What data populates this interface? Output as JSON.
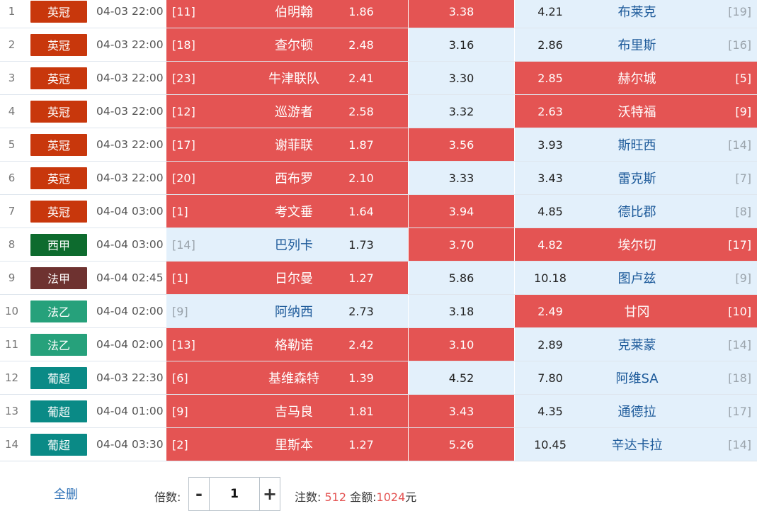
{
  "rows": [
    {
      "index": "1",
      "league": "英冠",
      "league_color": "#c8370c",
      "time": "04-03 22:00",
      "home_rank": "[11]",
      "home": "伯明翰",
      "home_odds": "1.86",
      "draw_odds": "3.38",
      "away_odds": "4.21",
      "away": "布莱克",
      "away_rank": "[19]",
      "selected": {
        "home": true,
        "draw": true,
        "away": false
      }
    },
    {
      "index": "2",
      "league": "英冠",
      "league_color": "#c8370c",
      "time": "04-03 22:00",
      "home_rank": "[18]",
      "home": "查尔顿",
      "home_odds": "2.48",
      "draw_odds": "3.16",
      "away_odds": "2.86",
      "away": "布里斯",
      "away_rank": "[16]",
      "selected": {
        "home": true,
        "draw": false,
        "away": false
      }
    },
    {
      "index": "3",
      "league": "英冠",
      "league_color": "#c8370c",
      "time": "04-03 22:00",
      "home_rank": "[23]",
      "home": "牛津联队",
      "home_odds": "2.41",
      "draw_odds": "3.30",
      "away_odds": "2.85",
      "away": "赫尔城",
      "away_rank": "[5]",
      "selected": {
        "home": true,
        "draw": false,
        "away": true
      }
    },
    {
      "index": "4",
      "league": "英冠",
      "league_color": "#c8370c",
      "time": "04-03 22:00",
      "home_rank": "[12]",
      "home": "巡游者",
      "home_odds": "2.58",
      "draw_odds": "3.32",
      "away_odds": "2.63",
      "away": "沃特福",
      "away_rank": "[9]",
      "selected": {
        "home": true,
        "draw": false,
        "away": true
      }
    },
    {
      "index": "5",
      "league": "英冠",
      "league_color": "#c8370c",
      "time": "04-03 22:00",
      "home_rank": "[17]",
      "home": "谢菲联",
      "home_odds": "1.87",
      "draw_odds": "3.56",
      "away_odds": "3.93",
      "away": "斯旺西",
      "away_rank": "[14]",
      "selected": {
        "home": true,
        "draw": true,
        "away": false
      }
    },
    {
      "index": "6",
      "league": "英冠",
      "league_color": "#c8370c",
      "time": "04-03 22:00",
      "home_rank": "[20]",
      "home": "西布罗",
      "home_odds": "2.10",
      "draw_odds": "3.33",
      "away_odds": "3.43",
      "away": "雷克斯",
      "away_rank": "[7]",
      "selected": {
        "home": true,
        "draw": false,
        "away": false
      }
    },
    {
      "index": "7",
      "league": "英冠",
      "league_color": "#c8370c",
      "time": "04-04 03:00",
      "home_rank": "[1]",
      "home": "考文垂",
      "home_odds": "1.64",
      "draw_odds": "3.94",
      "away_odds": "4.85",
      "away": "德比郡",
      "away_rank": "[8]",
      "selected": {
        "home": true,
        "draw": true,
        "away": false
      }
    },
    {
      "index": "8",
      "league": "西甲",
      "league_color": "#0d6b2e",
      "time": "04-04 03:00",
      "home_rank": "[14]",
      "home": "巴列卡",
      "home_odds": "1.73",
      "draw_odds": "3.70",
      "away_odds": "4.82",
      "away": "埃尔切",
      "away_rank": "[17]",
      "selected": {
        "home": false,
        "draw": true,
        "away": true
      }
    },
    {
      "index": "9",
      "league": "法甲",
      "league_color": "#6e3230",
      "time": "04-04 02:45",
      "home_rank": "[1]",
      "home": "日尔曼",
      "home_odds": "1.27",
      "draw_odds": "5.86",
      "away_odds": "10.18",
      "away": "图卢兹",
      "away_rank": "[9]",
      "selected": {
        "home": true,
        "draw": false,
        "away": false
      }
    },
    {
      "index": "10",
      "league": "法乙",
      "league_color": "#26a17b",
      "time": "04-04 02:00",
      "home_rank": "[9]",
      "home": "阿纳西",
      "home_odds": "2.73",
      "draw_odds": "3.18",
      "away_odds": "2.49",
      "away": "甘冈",
      "away_rank": "[10]",
      "selected": {
        "home": false,
        "draw": false,
        "away": true
      }
    },
    {
      "index": "11",
      "league": "法乙",
      "league_color": "#26a17b",
      "time": "04-04 02:00",
      "home_rank": "[13]",
      "home": "格勒诺",
      "home_odds": "2.42",
      "draw_odds": "3.10",
      "away_odds": "2.89",
      "away": "克莱蒙",
      "away_rank": "[14]",
      "selected": {
        "home": true,
        "draw": true,
        "away": false
      }
    },
    {
      "index": "12",
      "league": "葡超",
      "league_color": "#0a8a86",
      "time": "04-03 22:30",
      "home_rank": "[6]",
      "home": "基维森特",
      "home_odds": "1.39",
      "draw_odds": "4.52",
      "away_odds": "7.80",
      "away": "阿维SA",
      "away_rank": "[18]",
      "selected": {
        "home": true,
        "draw": false,
        "away": false
      }
    },
    {
      "index": "13",
      "league": "葡超",
      "league_color": "#0a8a86",
      "time": "04-04 01:00",
      "home_rank": "[9]",
      "home": "吉马良",
      "home_odds": "1.81",
      "draw_odds": "3.43",
      "away_odds": "4.35",
      "away": "通德拉",
      "away_rank": "[17]",
      "selected": {
        "home": true,
        "draw": true,
        "away": false
      }
    },
    {
      "index": "14",
      "league": "葡超",
      "league_color": "#0a8a86",
      "time": "04-04 03:30",
      "home_rank": "[2]",
      "home": "里斯本",
      "home_odds": "1.27",
      "draw_odds": "5.26",
      "away_odds": "10.45",
      "away": "辛达卡拉",
      "away_rank": "[14]",
      "selected": {
        "home": true,
        "draw": true,
        "away": false
      }
    }
  ],
  "footer": {
    "clear_all": "全删",
    "multiplier_label": "倍数:",
    "minus": "-",
    "plus": "+",
    "multiplier_value": "1",
    "bets_label": "注数:",
    "bets_value": "512",
    "amount_label": "金额:",
    "amount_value": "1024",
    "currency": "元"
  },
  "colors": {
    "selected_bg": "#e45453",
    "unselected_bg": "#e3f0fb",
    "accent_number": "#e45453",
    "link": "#2b6fb5"
  }
}
